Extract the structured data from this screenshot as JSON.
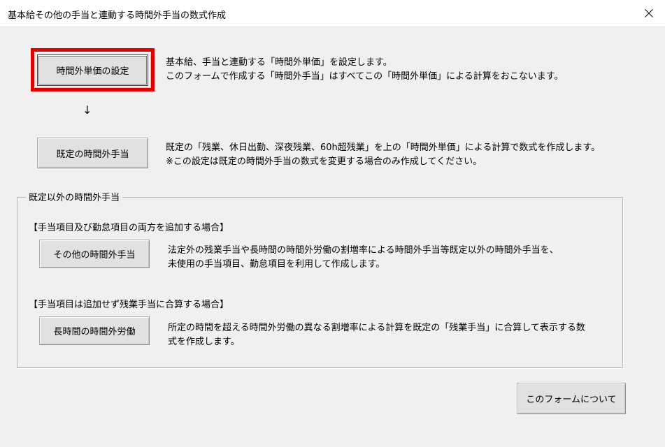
{
  "window": {
    "title": "基本給その他の手当と連動する時間外手当の数式作成",
    "close_glyph": "✕"
  },
  "buttons": {
    "overtime_unit_price": "時間外単価の設定",
    "default_overtime": "既定の時間外手当",
    "other_overtime": "その他の時間外手当",
    "long_hours_overtime": "長時間の時間外労働",
    "about_form": "このフォームについて"
  },
  "descriptions": {
    "unit_price_line1": "基本給、手当と連動する「時間外単価」を設定します。",
    "unit_price_line2": "このフォームで作成する「時間外手当」はすべてこの「時間外単価」による計算をおこないます。",
    "default_line1": "既定の「残業、休日出勤、深夜残業、60h超残業」を上の「時間外単価」による計算で数式を作成します。",
    "default_line2": "※この設定は既定の時間外手当の数式を変更する場合のみ作成してください。",
    "other_line1": "法定外の残業手当や長時間の時間外労働の割増率による時間外手当等既定以外の時間外手当を、",
    "other_line2": "未使用の手当項目、勤怠項目を利用して作成します。",
    "long_line1": "所定の時間を超える時間外労働の異なる割増率による計算を既定の「残業手当」に合算して表示する数",
    "long_line2": "式を作成します。"
  },
  "arrow": "↓",
  "group": {
    "title": "既定以外の時間外手当",
    "section1_label": "【手当項目及び勤怠項目の両方を追加する場合】",
    "section2_label": "【手当項目は追加せず残業手当に合算する場合】"
  },
  "colors": {
    "highlight": "#e00000",
    "window_bg": "#f0f0f0",
    "button_bg": "#e1e1e1"
  }
}
